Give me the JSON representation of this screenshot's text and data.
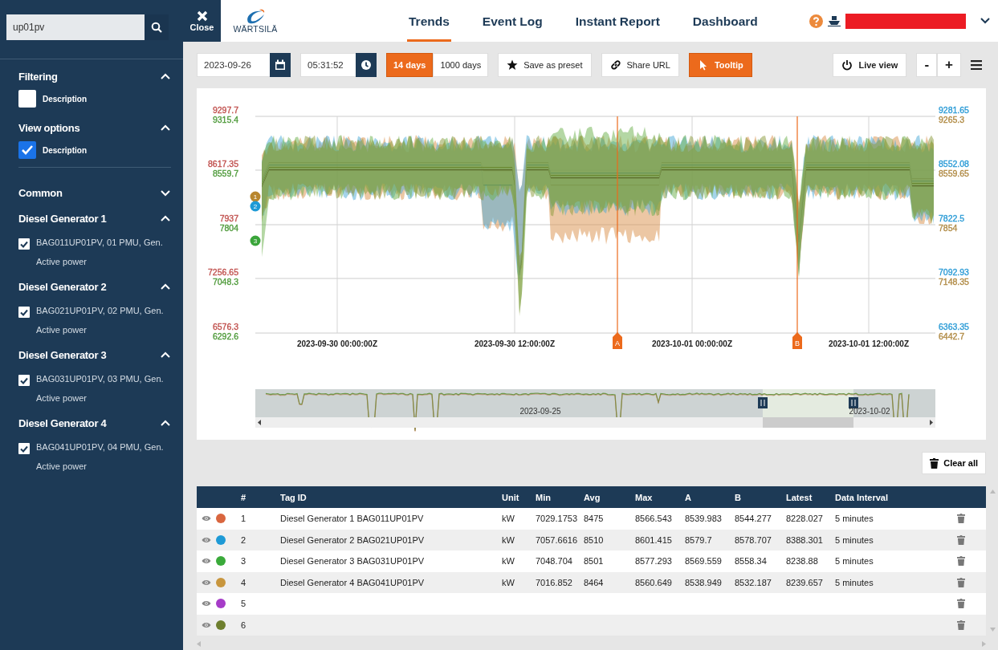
{
  "search": {
    "value": "up01pv"
  },
  "sidebar": {
    "sections": [
      {
        "title": "Filtering",
        "expanded": true,
        "options": [
          {
            "label": "Description",
            "checked": false
          }
        ]
      },
      {
        "title": "View options",
        "expanded": true,
        "options": [
          {
            "label": "Description",
            "checked": true
          }
        ]
      }
    ],
    "groups": [
      {
        "title": "Common",
        "expanded": false
      },
      {
        "title": "Diesel Generator 1",
        "expanded": true,
        "tags": [
          {
            "label": "BAG011UP01PV, 01 PMU, Gen. Active power",
            "checked": true
          }
        ]
      },
      {
        "title": "Diesel Generator 2",
        "expanded": true,
        "tags": [
          {
            "label": "BAG021UP01PV, 02 PMU, Gen. Active power",
            "checked": true
          }
        ]
      },
      {
        "title": "Diesel Generator 3",
        "expanded": true,
        "tags": [
          {
            "label": "BAG031UP01PV, 03 PMU, Gen. Active power",
            "checked": true
          }
        ]
      },
      {
        "title": "Diesel Generator 4",
        "expanded": true,
        "tags": [
          {
            "label": "BAG041UP01PV, 04 PMU, Gen. Active power",
            "checked": true
          }
        ]
      }
    ]
  },
  "header": {
    "close_label": "Close",
    "logo_text": "WÄRTSILÄ",
    "tabs": [
      {
        "label": "Trends",
        "selected": true
      },
      {
        "label": "Event Log",
        "selected": false
      },
      {
        "label": "Instant Report",
        "selected": false
      },
      {
        "label": "Dashboard",
        "selected": false
      }
    ]
  },
  "toolbar": {
    "date": "2023-09-26",
    "time": "05:31:52",
    "ranges": [
      {
        "label": "14 days",
        "selected": true
      },
      {
        "label": "1000 days",
        "selected": false
      }
    ],
    "save_preset": "Save as preset",
    "share_url": "Share URL",
    "tooltip": {
      "label": "Tooltip",
      "on": true
    },
    "live_view": "Live view",
    "zoom_out": "-",
    "zoom_in": "+"
  },
  "chart": {
    "left_axis": [
      {
        "labels": [
          {
            "text": "9297.7",
            "color": "#c0504d"
          },
          {
            "text": "9315.4",
            "color": "#4e9a3a"
          }
        ]
      },
      {
        "labels": [
          {
            "text": "8617.35",
            "color": "#c0504d"
          },
          {
            "text": "8559.7",
            "color": "#4e9a3a"
          }
        ]
      },
      {
        "labels": [
          {
            "text": "7937",
            "color": "#c0504d"
          },
          {
            "text": "7804",
            "color": "#4e9a3a"
          }
        ]
      },
      {
        "labels": [
          {
            "text": "7256.65",
            "color": "#c0504d"
          },
          {
            "text": "7048.3",
            "color": "#4e9a3a"
          }
        ]
      },
      {
        "labels": [
          {
            "text": "6576.3",
            "color": "#c0504d"
          },
          {
            "text": "6292.6",
            "color": "#4e9a3a"
          }
        ]
      }
    ],
    "right_axis": [
      {
        "labels": [
          {
            "text": "9281.65",
            "color": "#2b9bd6"
          },
          {
            "text": "9265.3",
            "color": "#b08a44"
          }
        ]
      },
      {
        "labels": [
          {
            "text": "8552.08",
            "color": "#2b9bd6"
          },
          {
            "text": "8559.65",
            "color": "#b08a44"
          }
        ]
      },
      {
        "labels": [
          {
            "text": "7822.5",
            "color": "#2b9bd6"
          },
          {
            "text": "7854",
            "color": "#b08a44"
          }
        ]
      },
      {
        "labels": [
          {
            "text": "7092.93",
            "color": "#2b9bd6"
          },
          {
            "text": "7148.35",
            "color": "#b08a44"
          }
        ]
      },
      {
        "labels": [
          {
            "text": "6363.35",
            "color": "#2b9bd6"
          },
          {
            "text": "6442.7",
            "color": "#b08a44"
          }
        ]
      }
    ],
    "x_labels": [
      "2023-09-30 00:00:00Z",
      "2023-09-30 12:00:00Z",
      "2023-10-01 00:00:00Z",
      "2023-10-01 12:00:00Z"
    ],
    "markers": [
      {
        "label": "A"
      },
      {
        "label": "B"
      }
    ],
    "series_badges": [
      {
        "label": "1",
        "color": "#b8862e"
      },
      {
        "label": "2",
        "color": "#1e9ad6"
      },
      {
        "label": "3",
        "color": "#3aa53a"
      }
    ],
    "navigator_labels": [
      "2023-09-25",
      "2023-10-02"
    ]
  },
  "clear_all": "Clear all",
  "table": {
    "columns": [
      "#",
      "Tag ID",
      "Unit",
      "Min",
      "Avg",
      "Max",
      "A",
      "B",
      "Latest",
      "Data Interval"
    ],
    "rows": [
      {
        "cells": [
          "1",
          "Diesel Generator 1 BAG011UP01PV",
          "kW",
          "7029.1753",
          "8475",
          "8566.543",
          "8539.983",
          "8544.277",
          "8228.027",
          "5 minutes"
        ],
        "color": "#d9663f"
      },
      {
        "cells": [
          "2",
          "Diesel Generator 2 BAG021UP01PV",
          "kW",
          "7057.6616",
          "8510",
          "8601.415",
          "8579.7",
          "8578.707",
          "8388.301",
          "5 minutes"
        ],
        "color": "#1e9ad6"
      },
      {
        "cells": [
          "3",
          "Diesel Generator 3 BAG031UP01PV",
          "kW",
          "7048.704",
          "8501",
          "8577.293",
          "8569.559",
          "8558.34",
          "8238.88",
          "5 minutes"
        ],
        "color": "#3aaa3a"
      },
      {
        "cells": [
          "4",
          "Diesel Generator 4 BAG041UP01PV",
          "kW",
          "7016.852",
          "8464",
          "8560.649",
          "8538.949",
          "8532.187",
          "8239.657",
          "5 minutes"
        ],
        "color": "#c8963e"
      },
      {
        "cells": [
          "5"
        ],
        "color": "#a63cc8"
      },
      {
        "cells": [
          "6"
        ],
        "color": "#6e7f2e"
      }
    ]
  }
}
